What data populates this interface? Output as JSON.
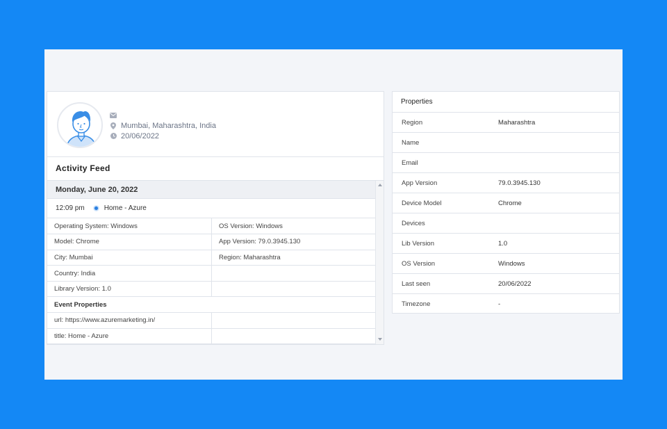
{
  "profile": {
    "location": "Mumbai, Maharashtra, India",
    "date": "20/06/2022",
    "icons": [
      "envelope-icon",
      "map-pin-icon",
      "clock-icon"
    ]
  },
  "activity": {
    "title": "Activity Feed",
    "date_header": "Monday, June 20, 2022",
    "event": {
      "time": "12:09 pm",
      "name": "Home - Azure"
    },
    "rows": [
      [
        "Operating System: Windows",
        "OS Version: Windows"
      ],
      [
        "Model: Chrome",
        "App Version: 79.0.3945.130"
      ],
      [
        "City: Mumbai",
        "Region: Maharashtra"
      ],
      [
        "Country: India",
        ""
      ],
      [
        "Library Version: 1.0",
        ""
      ]
    ],
    "section": "Event Properties",
    "event_rows": [
      [
        "url: https://www.azuremarketing.in/",
        ""
      ],
      [
        "title: Home - Azure",
        ""
      ]
    ]
  },
  "properties": {
    "title": "Properties",
    "rows": [
      {
        "key": "Region",
        "value": "Maharashtra"
      },
      {
        "key": "Name",
        "value": ""
      },
      {
        "key": "Email",
        "value": ""
      },
      {
        "key": "App Version",
        "value": "79.0.3945.130"
      },
      {
        "key": "Device Model",
        "value": "Chrome"
      },
      {
        "key": "Devices",
        "value": ""
      },
      {
        "key": "Lib Version",
        "value": "1.0"
      },
      {
        "key": "OS Version",
        "value": "Windows"
      },
      {
        "key": "Last seen",
        "value": "20/06/2022"
      },
      {
        "key": "Timezone",
        "value": "-"
      }
    ]
  },
  "colors": {
    "background": "#1488f5",
    "accent": "#2a7fe0",
    "avatar": "#3a8ee6"
  }
}
